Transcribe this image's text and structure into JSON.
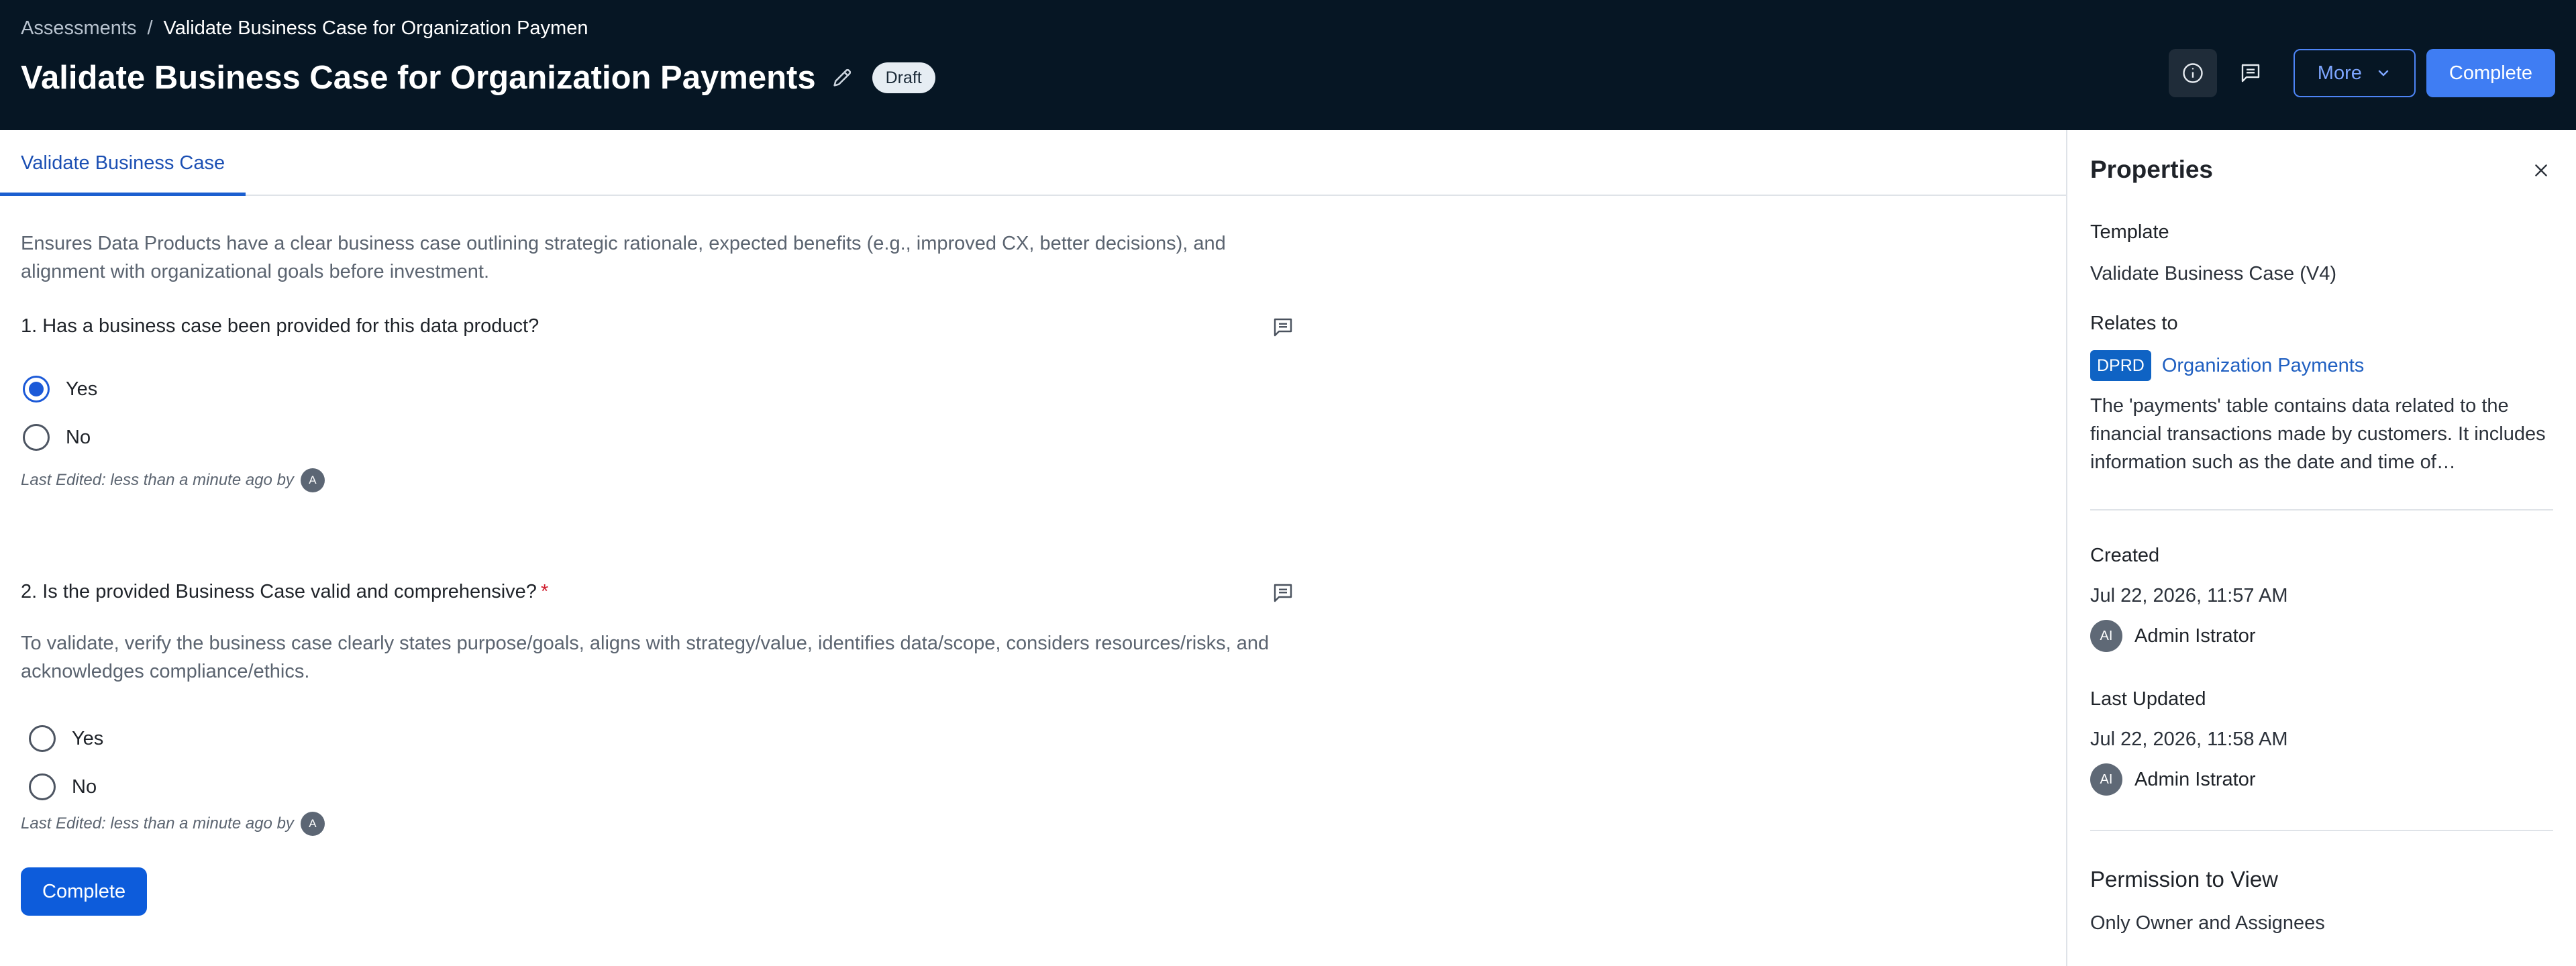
{
  "header": {
    "breadcrumb": {
      "parent": "Assessments",
      "separator": "/",
      "current": "Validate Business Case for Organization Paymen"
    },
    "title": "Validate Business Case for Organization Payments",
    "status_badge": "Draft",
    "more_label": "More",
    "complete_label": "Complete"
  },
  "tabs": [
    {
      "label": "Validate Business Case"
    }
  ],
  "assessment": {
    "description": "Ensures Data Products have a clear business case outlining strategic rationale, expected benefits (e.g., improved CX, better decisions), and alignment with organizational goals before investment.",
    "questions": [
      {
        "title": "1. Has a business case been provided for this data product?",
        "options": [
          "Yes",
          "No"
        ],
        "selected": "Yes",
        "last_edited": "Last Edited: less than a minute ago by",
        "editor_initial": "A"
      },
      {
        "title": "2. Is the provided Business Case valid and comprehensive?",
        "required_mark": "*",
        "help_text": "To validate, verify the business case clearly states purpose/goals, aligns with strategy/value, identifies data/scope, considers resources/risks, and acknowledges compliance/ethics.",
        "options": [
          "Yes",
          "No"
        ],
        "selected": null,
        "last_edited": "Last Edited: less than a minute ago by",
        "editor_initial": "A"
      }
    ],
    "complete_label": "Complete"
  },
  "properties": {
    "title": "Properties",
    "template_label": "Template",
    "template_value": "Validate Business Case (V4)",
    "relates_label": "Relates to",
    "relates_badge": "DPRD",
    "relates_name": "Organization Payments",
    "relates_description": "The 'payments' table contains data related to the financial transactions made by customers. It includes information such as the date and time of…",
    "created_label": "Created",
    "created_date": "Jul 22, 2026, 11:57 AM",
    "created_by_initials": "AI",
    "created_by": "Admin Istrator",
    "updated_label": "Last Updated",
    "updated_date": "Jul 22, 2026, 11:58 AM",
    "updated_by_initials": "AI",
    "updated_by": "Admin Istrator",
    "permission_title": "Permission to View",
    "permission_value": "Only Owner and Assignees"
  },
  "icons": {
    "edit": "pencil-icon",
    "info": "info-icon",
    "comments": "comment-icon",
    "chevron": "chevron-down-icon",
    "close": "close-icon"
  },
  "colors": {
    "header_bg": "#061624",
    "primary": "#0d5cdb",
    "accent_link": "#1f5fc1",
    "radio_selected": "#1c5ad8",
    "required": "#cf1c2c"
  }
}
